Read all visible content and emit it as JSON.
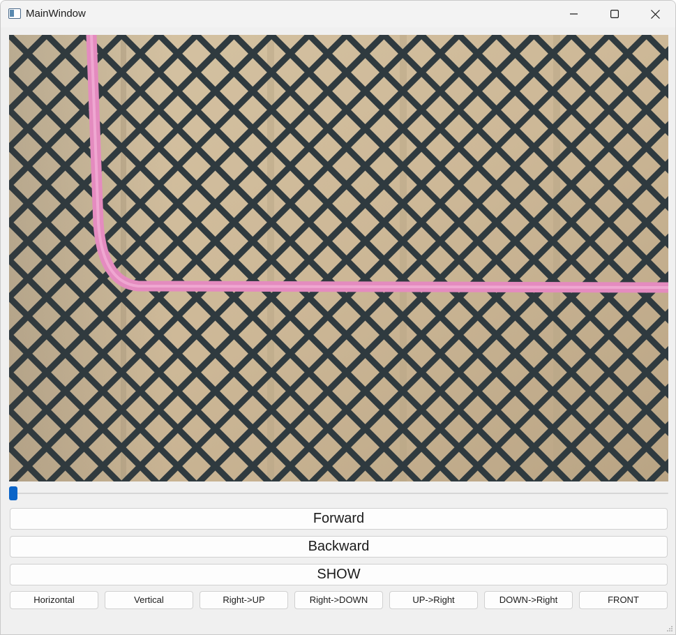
{
  "window": {
    "title": "MainWindow",
    "controls": {
      "minimize_icon": "minimize-icon",
      "maximize_icon": "maximize-icon",
      "close_icon": "close-icon"
    }
  },
  "video": {
    "description_icon": "video-frame",
    "colors": {
      "background": "#c9b696",
      "mesh": "#2f3a3f",
      "cable": "#e48bbf"
    }
  },
  "slider": {
    "value_fraction": 0.0,
    "handle_color": "#0a64c8"
  },
  "buttons": {
    "forward": "Forward",
    "backward": "Backward",
    "show": "SHOW"
  },
  "direction_buttons": [
    "Horizontal",
    "Vertical",
    "Right->UP",
    "Right->DOWN",
    "UP->Right",
    "DOWN->Right",
    "FRONT"
  ]
}
